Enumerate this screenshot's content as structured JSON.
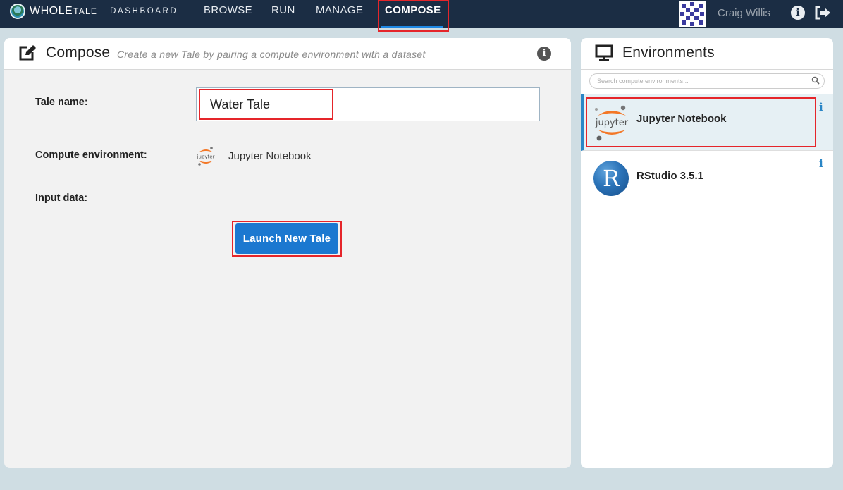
{
  "nav": {
    "brand_whole": "WHOLE",
    "brand_tale": "TALE",
    "brand_dashboard": "DASHBOARD",
    "items": [
      {
        "label": "BROWSE"
      },
      {
        "label": "RUN"
      },
      {
        "label": "MANAGE"
      },
      {
        "label": "COMPOSE",
        "active": true
      }
    ],
    "user_name": "Craig Willis",
    "info_glyph": "i"
  },
  "compose": {
    "title": "Compose",
    "subtitle": "Create a new Tale by pairing a compute environment with a dataset",
    "info_glyph": "i",
    "tale_name_label": "Tale name:",
    "tale_name_value": "Water Tale",
    "compute_env_label": "Compute environment:",
    "compute_env_value": "Jupyter Notebook",
    "input_data_label": "Input data:",
    "launch_label": "Launch New Tale"
  },
  "environments": {
    "title": "Environments",
    "search_placeholder": "Search compute environments...",
    "items": [
      {
        "name": "Jupyter Notebook",
        "selected": true,
        "info_glyph": "i",
        "logo_text": "jupyter"
      },
      {
        "name": "RStudio 3.5.1",
        "selected": false,
        "info_glyph": "i",
        "logo_text": "R"
      }
    ]
  },
  "colors": {
    "nav_bg": "#1b2d44",
    "page_bg": "#cfdde3",
    "accent_blue": "#1b78d0",
    "highlight_red": "#e5252a",
    "jupyter_orange": "#f37726",
    "selected_row_bg": "#e6f0f4"
  },
  "icons": {
    "brand": "wholetale-globe-icon",
    "avatar": "user-identicon",
    "info": "info-circle-icon",
    "logout": "sign-out-icon",
    "compose": "edit-square-icon",
    "environments": "monitor-icon",
    "search": "search-icon"
  }
}
